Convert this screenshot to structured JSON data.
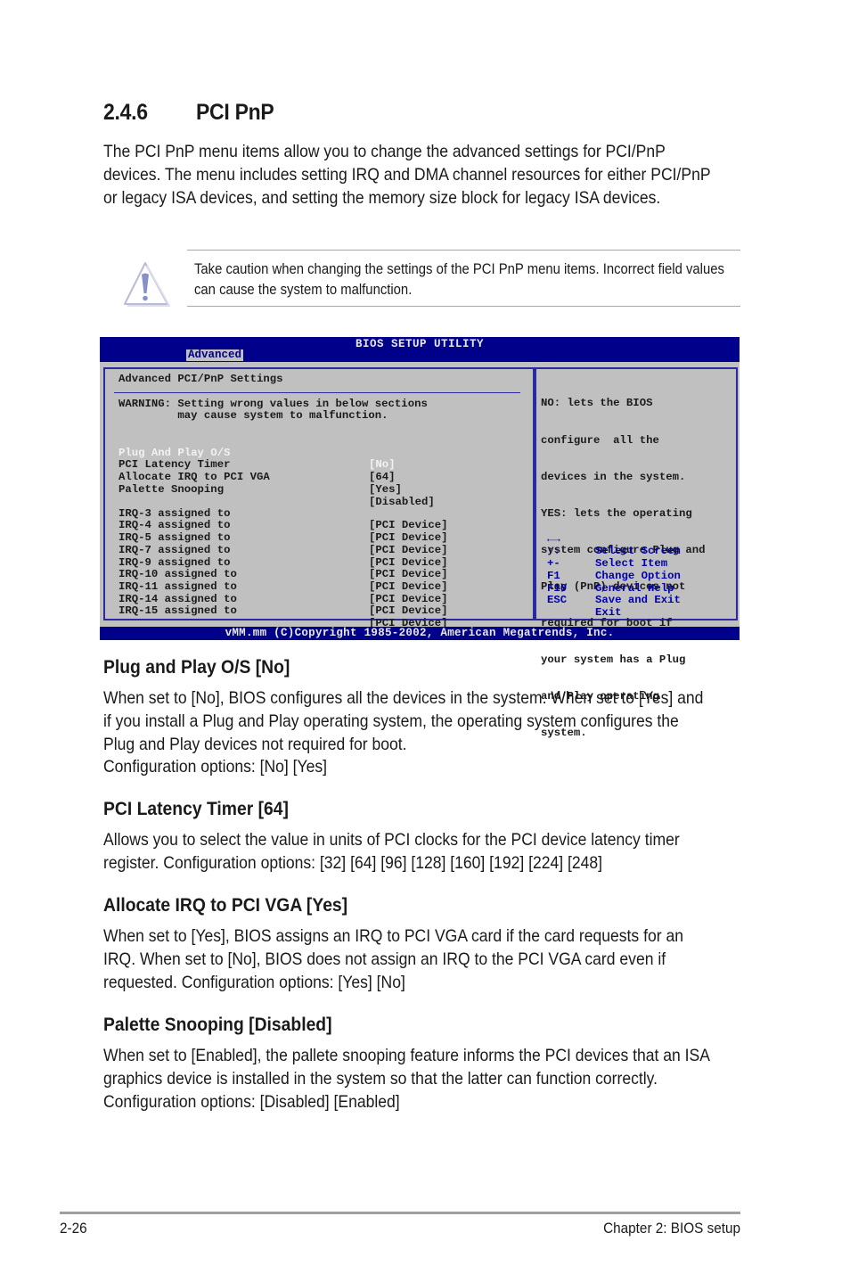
{
  "section": {
    "number": "2.4.6",
    "title": "PCI PnP",
    "intro": "The PCI PnP menu items allow you to change the advanced settings for PCI/PnP devices. The menu includes setting IRQ and DMA channel resources for either PCI/PnP or legacy ISA devices, and setting the memory size block for legacy ISA devices."
  },
  "caution": {
    "icon": "warning-triangle-icon",
    "text": "Take caution when changing the settings of the PCI PnP menu items. Incorrect field values can cause the system to malfunction."
  },
  "bios": {
    "title": "BIOS SETUP UTILITY",
    "active_tab": "Advanced",
    "panel_title": "Advanced PCI/PnP Settings",
    "warning_line1": "WARNING: Setting wrong values in below sections",
    "warning_line2": "         may cause system to malfunction.",
    "settings": [
      {
        "label": "Plug And Play O/S",
        "value": "[No]",
        "highlighted": true
      },
      {
        "label": "PCI Latency Timer",
        "value": "[64]"
      },
      {
        "label": "Allocate IRQ to PCI VGA",
        "value": "[Yes]"
      },
      {
        "label": "Palette Snooping",
        "value": "[Disabled]"
      }
    ],
    "irqs": [
      {
        "label": "IRQ-3 assigned to",
        "value": "[PCI Device]"
      },
      {
        "label": "IRQ-4 assigned to",
        "value": "[PCI Device]"
      },
      {
        "label": "IRQ-5 assigned to",
        "value": "[PCI Device]"
      },
      {
        "label": "IRQ-7 assigned to",
        "value": "[PCI Device]"
      },
      {
        "label": "IRQ-9 assigned to",
        "value": "[PCI Device]"
      },
      {
        "label": "IRQ-10 assigned to",
        "value": "[PCI Device]"
      },
      {
        "label": "IRQ-11 assigned to",
        "value": "[PCI Device]"
      },
      {
        "label": "IRQ-14 assigned to",
        "value": "[PCI Device]"
      },
      {
        "label": "IRQ-15 assigned to",
        "value": "[PCI Device]"
      }
    ],
    "help_lines": [
      "NO: lets the BIOS",
      "configure  all the",
      "devices in the system.",
      "YES: lets the operating",
      "system configure Plug and",
      "Play (PnP) devices not",
      "required for boot if",
      "your system has a Plug",
      "and Play operating",
      "system."
    ],
    "keys": [
      {
        "key": "←→",
        "desc": "Select Screen"
      },
      {
        "key": "↑↓",
        "desc": "Select Item"
      },
      {
        "key": "+-",
        "desc": "Change Option"
      },
      {
        "key": "F1",
        "desc": "General Help"
      },
      {
        "key": "F10",
        "desc": "Save and Exit"
      },
      {
        "key": "ESC",
        "desc": "Exit"
      }
    ],
    "footer": "vMM.mm (C)Copyright 1985-2002, American Megatrends, Inc.",
    "colors": {
      "header_bg": "#00008b",
      "panel_bg": "#c0c0c0",
      "key_text": "#0000b0"
    }
  },
  "items": [
    {
      "heading": "Plug and Play O/S [No]",
      "body": "When set to [No], BIOS configures all the devices in the system. When set to [Yes] and if you install a Plug and Play operating system, the operating system configures the Plug and Play devices not required for boot.",
      "options": "Configuration options: [No] [Yes]"
    },
    {
      "heading": "PCI Latency Timer [64]",
      "body": "Allows you to select the value in units of PCI clocks for the PCI device latency timer register. Configuration options: [32] [64] [96] [128] [160] [192] [224] [248]"
    },
    {
      "heading": "Allocate IRQ to PCI VGA [Yes]",
      "body": "When set to [Yes], BIOS assigns an IRQ to PCI VGA card if the card requests for an IRQ. When set to [No], BIOS does not assign an IRQ to the PCI VGA card even if requested. Configuration options: [Yes] [No]"
    },
    {
      "heading": "Palette Snooping [Disabled]",
      "body": "When set to [Enabled], the pallete snooping feature informs the PCI devices that an ISA graphics device is installed in the system so that the latter can function correctly. Configuration options: [Disabled] [Enabled]"
    }
  ],
  "page_footer": {
    "page_number": "2-26",
    "chapter": "Chapter 2: BIOS setup"
  }
}
